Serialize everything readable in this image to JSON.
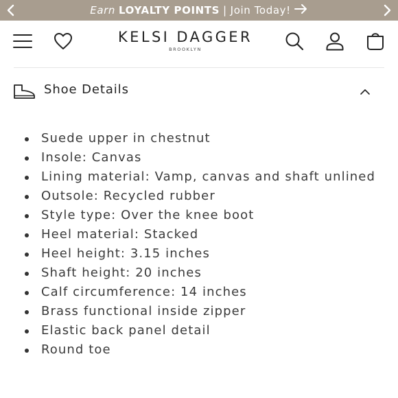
{
  "promo": {
    "earn": "Earn",
    "loyalty": "LOYALTY POINTS",
    "separator": "|",
    "join": "Join Today!",
    "arrow_icon": "arrow-right-icon"
  },
  "header": {
    "brand": "KELSI DAGGER",
    "brand_sub": "BROOKLYN",
    "icons": [
      "menu-icon",
      "heart-icon",
      "search-icon",
      "account-icon",
      "cart-icon"
    ]
  },
  "accordion": {
    "title": "Shoe Details",
    "icon": "shoe-icon",
    "state": "expanded"
  },
  "details": [
    "Suede upper in chestnut",
    "Insole: Canvas",
    "Lining material: Vamp, canvas and shaft unlined",
    "Outsole: Recycled rubber",
    "Style type: Over the knee boot",
    "Heel material: Stacked",
    "Heel height: 3.15 inches",
    "Shaft height: 20 inches",
    "Calf circumference: 14 inches",
    "Brass functional inside zipper",
    "Elastic back panel detail",
    "Round toe"
  ],
  "colors": {
    "promo_bg": "#a89d8f",
    "text": "#3a3a3a"
  }
}
